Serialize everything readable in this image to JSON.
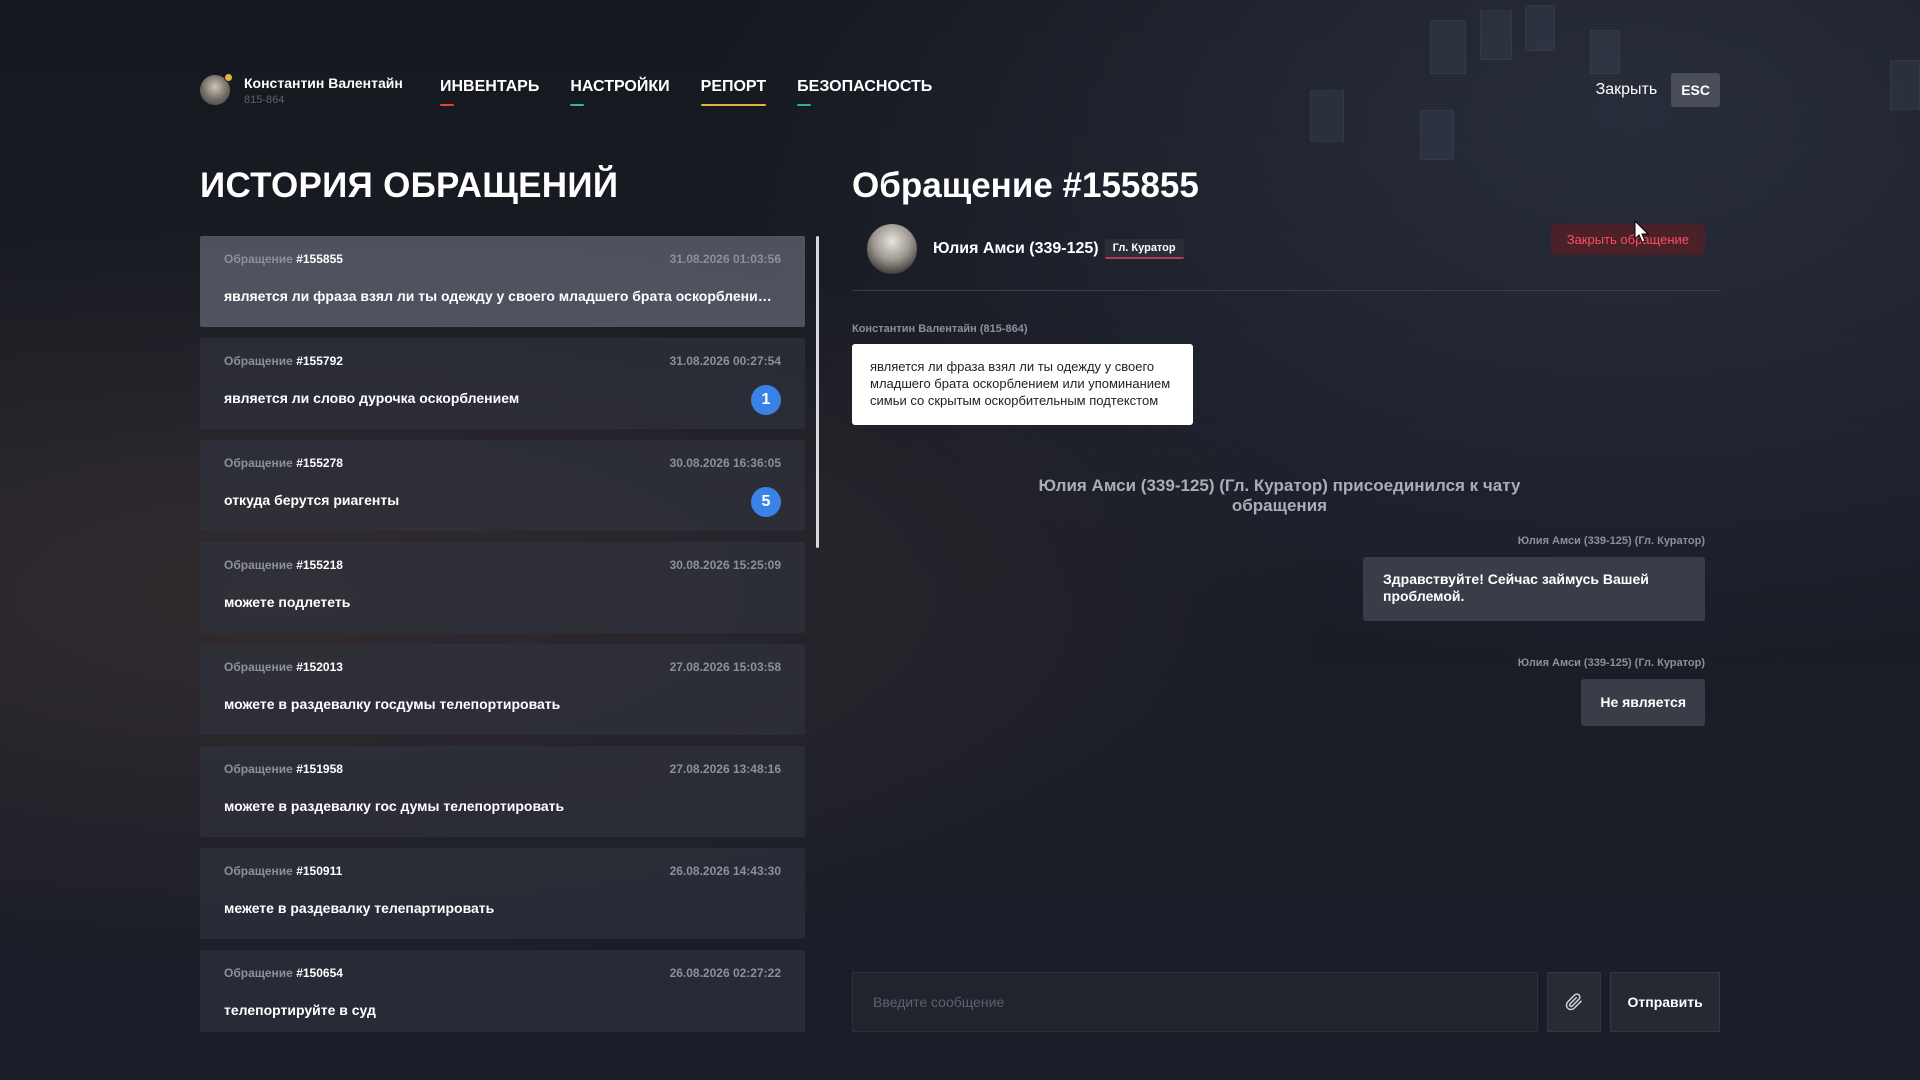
{
  "header": {
    "user_name": "Константин Валентайн",
    "user_id": "815-864",
    "nav": [
      {
        "label": "ИНВЕНТАРЬ",
        "color": "#e5413c",
        "active": false
      },
      {
        "label": "НАСТРОЙКИ",
        "color": "#2bb7b0",
        "active": false
      },
      {
        "label": "РЕПОРТ",
        "color": "#e3b341",
        "active": true
      },
      {
        "label": "БЕЗОПАСНОСТЬ",
        "color": "#2bb78a",
        "active": false
      }
    ],
    "close_label": "Закрыть",
    "esc_label": "ESC"
  },
  "history": {
    "title": "ИСТОРИЯ ОБРАЩЕНИЙ",
    "ticket_label": "Обращение",
    "tickets": [
      {
        "number": "#155855",
        "date": "31.08.2026 01:03:56",
        "text": "является ли фраза взял ли ты одежду у своего младшего брата оскорбление или упоминанием симьи со скрытым оскорбительным подтекстом",
        "badge": ""
      },
      {
        "number": "#155792",
        "date": "31.08.2026 00:27:54",
        "text": "является ли слово дурочка оскорблением",
        "badge": "1"
      },
      {
        "number": "#155278",
        "date": "30.08.2026 16:36:05",
        "text": "откуда берутся риагенты",
        "badge": "5"
      },
      {
        "number": "#155218",
        "date": "30.08.2026 15:25:09",
        "text": "можете подлететь",
        "badge": ""
      },
      {
        "number": "#152013",
        "date": "27.08.2026 15:03:58",
        "text": "можете в раздевалку госдумы телепортировать",
        "badge": ""
      },
      {
        "number": "#151958",
        "date": "27.08.2026 13:48:16",
        "text": "можете в раздевалку гос думы телепортировать",
        "badge": ""
      },
      {
        "number": "#150911",
        "date": "26.08.2026 14:43:30",
        "text": "межете в раздевалку телепартировать",
        "badge": ""
      },
      {
        "number": "#150654",
        "date": "26.08.2026 02:27:22",
        "text": "телепортируйте в суд",
        "badge": ""
      }
    ]
  },
  "chat": {
    "title": "Обращение #155855",
    "agent_name": "Юлия Амси (339-125)",
    "agent_role": "Гл. Куратор",
    "close_ticket_label": "Закрыть обращение",
    "messages": [
      {
        "author": "Константин Валентайн (815-864)",
        "text": "является ли фраза взял ли ты одежду у своего младшего брата оскорблением или упоминанием симьи со скрытым оскорбительным подтекстом"
      },
      {
        "author": "Юлия Амси (339-125) (Гл. Куратор)",
        "text": "Здравствуйте! Сейчас займусь Вашей проблемой."
      },
      {
        "author": "Юлия Амси (339-125) (Гл. Куратор)",
        "text": "Не является"
      }
    ],
    "system_message": "Юлия Амси (339-125) (Гл. Куратор) присоединился к чату обращения",
    "input_placeholder": "Введите сообщение",
    "send_label": "Отправить"
  }
}
